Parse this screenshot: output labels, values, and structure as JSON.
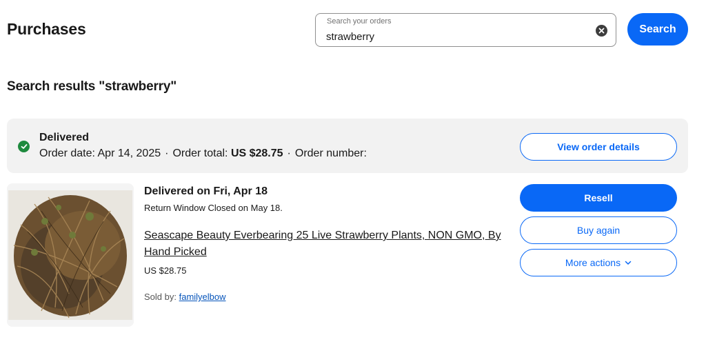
{
  "header": {
    "title": "Purchases"
  },
  "search": {
    "label": "Search your orders",
    "value": "strawberry",
    "button_label": "Search",
    "clear_icon": "clear-icon"
  },
  "results": {
    "heading": "Search results \"strawberry\""
  },
  "order": {
    "status": "Delivered",
    "status_icon": "check-circle-icon",
    "status_color": "#1e8a3e",
    "order_date_label": "Order date:",
    "order_date": "Apr 14, 2025",
    "order_total_label": "Order total:",
    "order_total": "US $28.75",
    "order_number_label": "Order number:",
    "separator": "·",
    "view_details_label": "View order details"
  },
  "item": {
    "delivered_on": "Delivered on Fri, Apr 18",
    "return_window": "Return Window Closed on May 18.",
    "title": "Seascape Beauty Everbearing 25 Live Strawberry Plants, NON GMO, By Hand Picked",
    "price": "US $28.75",
    "sold_by_label": "Sold by:",
    "seller": "familyelbow"
  },
  "actions": {
    "resell_label": "Resell",
    "buy_again_label": "Buy again",
    "more_actions_label": "More actions",
    "chevron_icon": "chevron-down-icon"
  },
  "colors": {
    "accent": "#0968f6",
    "link": "#0654ba",
    "card_bg": "#f2f2f2"
  }
}
